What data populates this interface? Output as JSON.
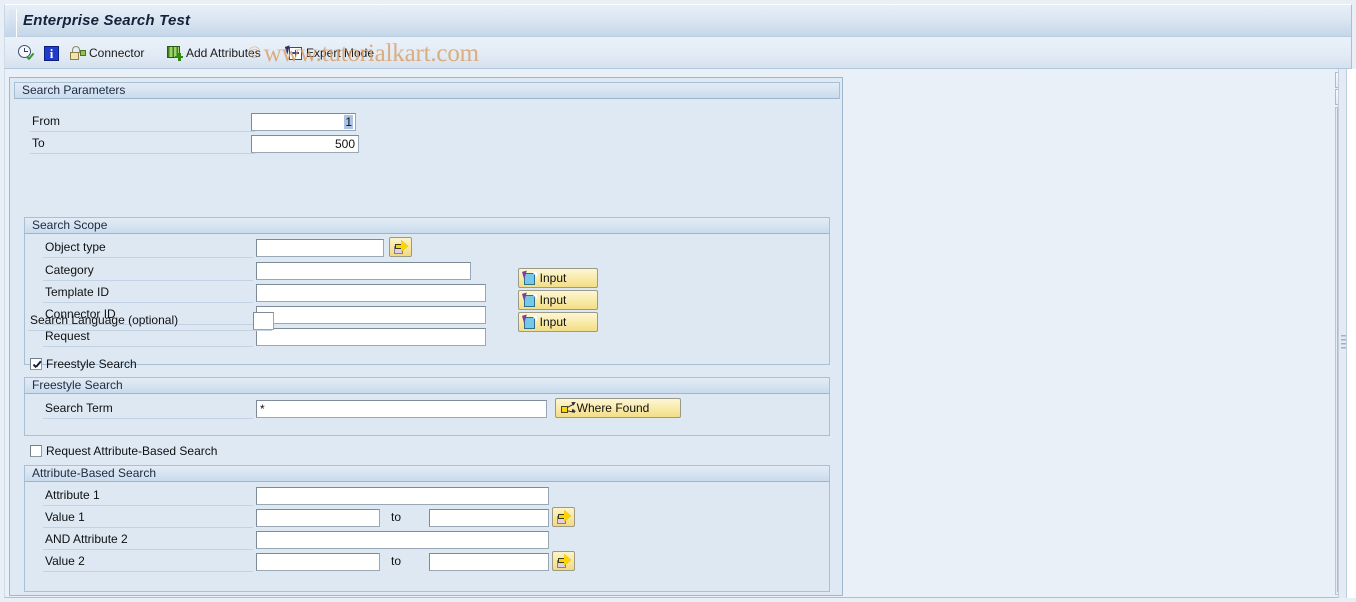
{
  "window": {
    "title": "Enterprise Search Test"
  },
  "watermark": {
    "symbol": "©",
    "text": "www.tutorialkart.com"
  },
  "toolbar": {
    "items": [
      {
        "icon": "clock-check-icon",
        "label": ""
      },
      {
        "icon": "info-icon",
        "label": ""
      },
      {
        "icon": "connector-icon",
        "label": "Connector"
      },
      {
        "icon": "add-attributes-icon",
        "label": "Add Attributes"
      },
      {
        "icon": "expert-mode-icon",
        "label": "Expert Mode"
      }
    ]
  },
  "search_parameters": {
    "group_title": "Search Parameters",
    "from": {
      "label": "From",
      "value": "1"
    },
    "to": {
      "label": "To",
      "value": "500"
    }
  },
  "search_scope": {
    "group_title": "Search Scope",
    "rows": [
      {
        "label": "Object type",
        "value": "",
        "placeholder": ""
      },
      {
        "label": "Category",
        "value": "",
        "placeholder": ""
      },
      {
        "label": "Template ID",
        "value": "",
        "placeholder": ""
      },
      {
        "label": "Connector ID",
        "value": "",
        "placeholder": ""
      },
      {
        "label": "Request",
        "value": "",
        "placeholder": ""
      }
    ],
    "input_buttons": [
      {
        "label": "Input",
        "icon": "page-cursor-icon"
      },
      {
        "label": "Input",
        "icon": "page-cursor-icon"
      },
      {
        "label": "Input",
        "icon": "page-cursor-icon"
      }
    ],
    "value_help_icon": "yellow-arrow-icon"
  },
  "search_language": {
    "label": "Search Language (optional)",
    "value": ""
  },
  "freestyle": {
    "checkbox_label": "Freestyle Search",
    "checked": true,
    "group_title": "Freestyle Search",
    "search_term": {
      "label": "Search Term",
      "value": "*"
    },
    "where_found_button": {
      "label": "Where Found",
      "icon": "where-found-icon"
    }
  },
  "attribute_based": {
    "checkbox_label": "Request Attribute-Based Search",
    "checked": false,
    "group_title": "Attribute-Based Search",
    "attribute1": {
      "label": "Attribute 1",
      "value": ""
    },
    "value1": {
      "label": "Value 1",
      "from": "",
      "to_label": "to",
      "to": ""
    },
    "attribute2": {
      "label": "AND Attribute 2",
      "value": ""
    },
    "value2": {
      "label": "Value 2",
      "from": "",
      "to_label": "to",
      "to": ""
    }
  },
  "colors": {
    "window_bg": "#eaf0f8",
    "panel_bg": "#dfe9f4",
    "group_header": "#d4e2f0",
    "button_yellow": "#f9ebaa",
    "watermark": "#d9a066",
    "title_text": "#14223a"
  }
}
